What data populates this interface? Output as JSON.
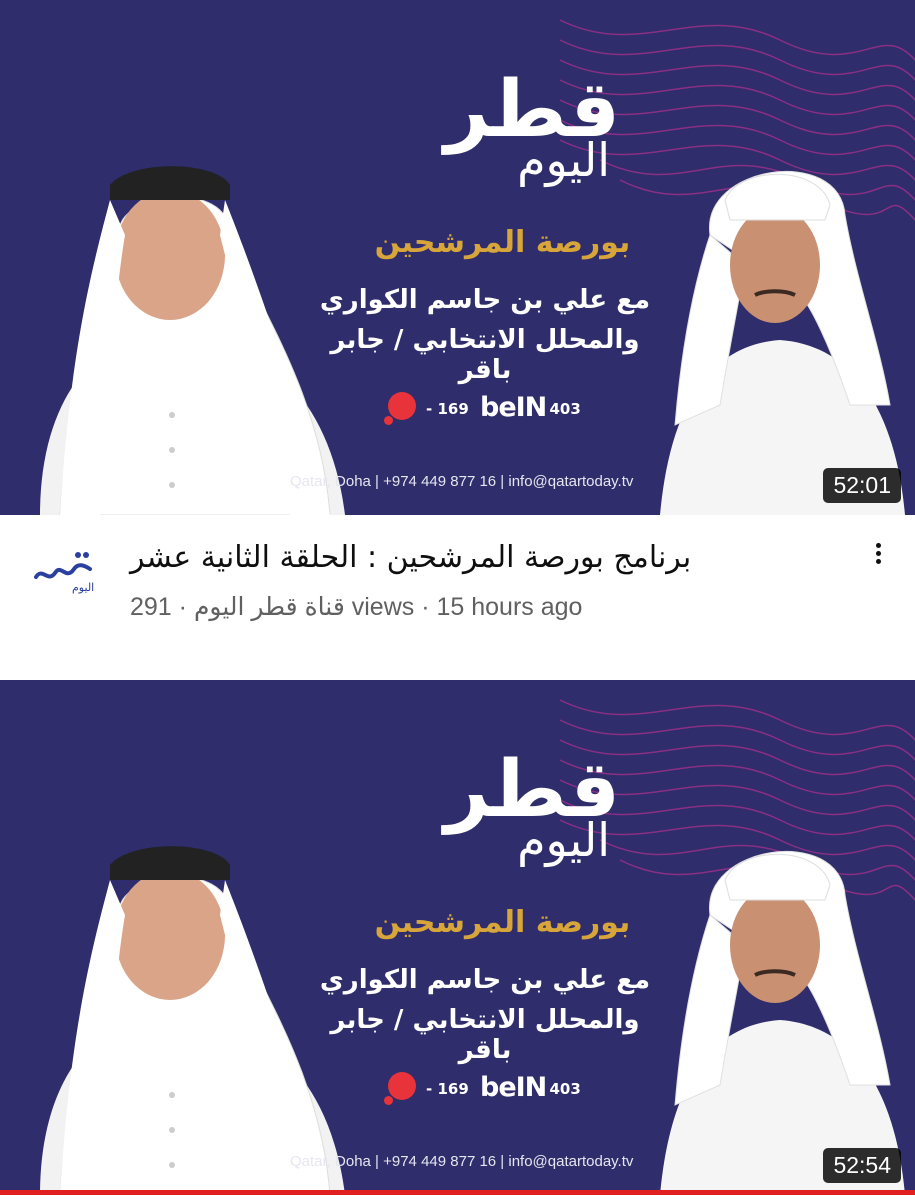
{
  "videos": [
    {
      "thumbnail": {
        "logo_main": "قطر",
        "logo_sub": "اليوم",
        "program": "بورصة المرشحين",
        "line1": "مع علي بن جاسم الكواري",
        "line2": "والمحلل الانتخابي / جابر باقر",
        "ch_num1": "- 169",
        "ch_bein": "beIN",
        "ch_num2": "- 403",
        "contact": "Qatar, Doha | +974 449 877 16 | info@qatartoday.tv"
      },
      "duration": "52:01",
      "title": "برنامج بورصة المرشحين : الحلقة الثانية عشر",
      "channel": "قناة قطر اليوم",
      "separator1": " · ",
      "views": "291 views",
      "separator2": " · ",
      "age": "15 hours ago"
    },
    {
      "thumbnail": {
        "logo_main": "قطر",
        "logo_sub": "اليوم",
        "program": "بورصة المرشحين",
        "line1": "مع علي بن جاسم الكواري",
        "line2": "والمحلل الانتخابي / جابر باقر",
        "ch_num1": "- 169",
        "ch_bein": "beIN",
        "ch_num2": "- 403",
        "contact": "Qatar, Doha | +974 449 877 16 | info@qatartoday.tv"
      },
      "duration": "52:54",
      "watched_fraction": 1.0
    }
  ],
  "avatar": {
    "logo_main": "قطر",
    "logo_sub": "اليوم"
  },
  "colors": {
    "thumb_bg": "#2f2d6b",
    "accent_gold": "#d8a53a",
    "wave": "#b0308f",
    "progress": "#e02020"
  }
}
